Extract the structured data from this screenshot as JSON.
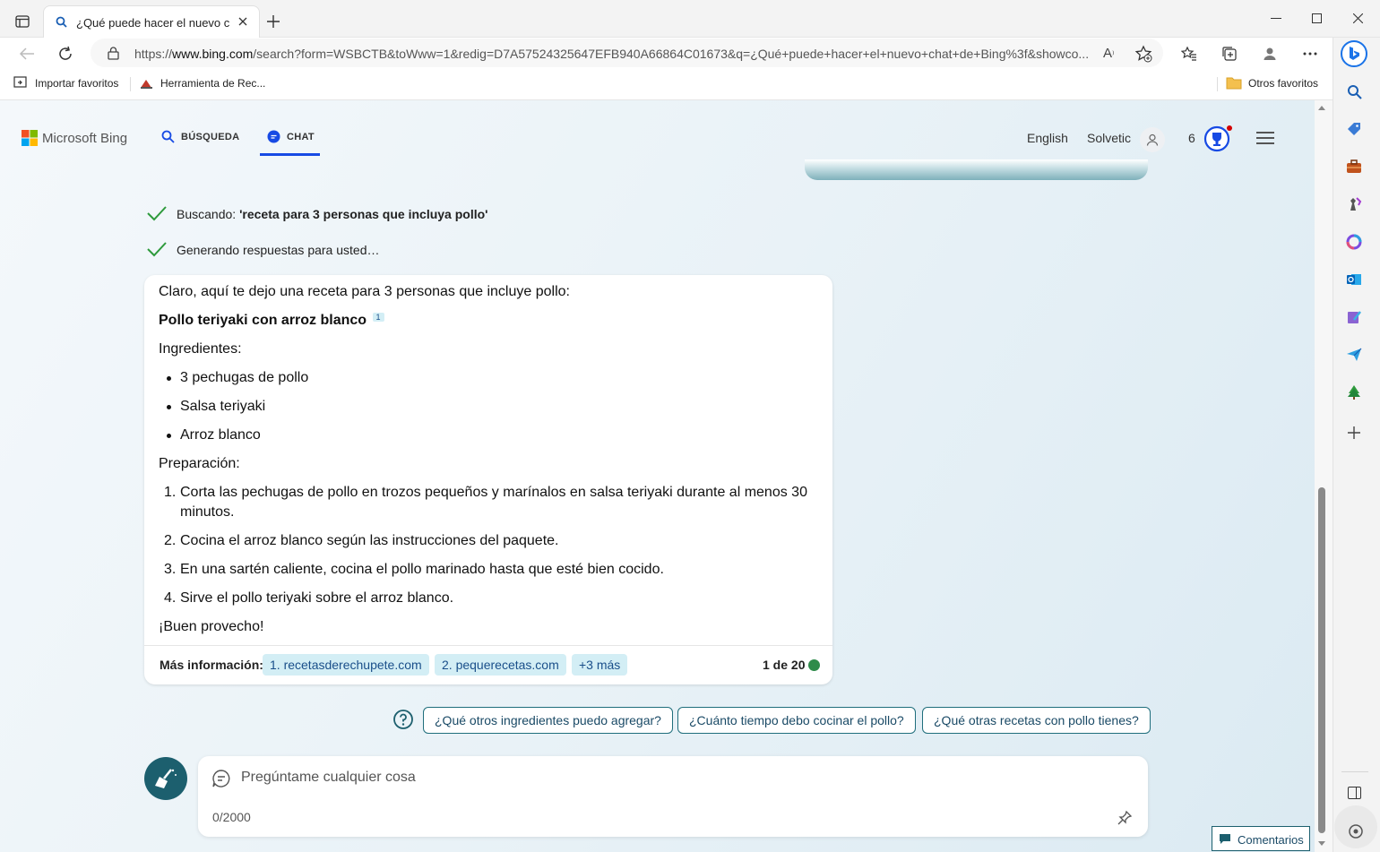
{
  "browser": {
    "tab_title": "¿Qué puede hacer el nuevo chat",
    "url_prefix": "https://",
    "url_host": "www.bing.com",
    "url_rest": "/search?form=WSBCTB&toWww=1&redig=D7A57524325647EFB940A66864C01673&q=¿Qué+puede+hacer+el+nuevo+chat+de+Bing%3f&showco...",
    "favorites": {
      "import": "Importar favoritos",
      "tool": "Herramienta de Rec...",
      "others": "Otros favoritos"
    }
  },
  "header": {
    "logo": "Microsoft Bing",
    "nav_search": "BÚSQUEDA",
    "nav_chat": "CHAT",
    "language": "English",
    "user": "Solvetic",
    "rewards_count": "6"
  },
  "chat": {
    "status_search_prefix": "Buscando: ",
    "status_search_query": "'receta para 3 personas que incluya pollo'",
    "status_generating": "Generando respuestas para usted…",
    "intro": "Claro, aquí te dejo una receta para 3 personas que incluye pollo:",
    "recipe_title": "Pollo teriyaki con arroz blanco",
    "citation": "1",
    "ingredients_heading": "Ingredientes:",
    "ingredients": [
      "3 pechugas de pollo",
      "Salsa teriyaki",
      "Arroz blanco"
    ],
    "prep_heading": "Preparación:",
    "steps": [
      {
        "num": "1.",
        "line1": "Corta las pechugas de pollo en trozos pequeños y marínalos en salsa teriyaki durante al menos 30",
        "line2": "minutos."
      },
      {
        "num": "2.",
        "line1": "Cocina el arroz blanco según las instrucciones del paquete."
      },
      {
        "num": "3.",
        "line1": "En una sartén caliente, cocina el pollo marinado hasta que esté bien cocido."
      },
      {
        "num": "4.",
        "line1": "Sirve el pollo teriyaki sobre el arroz blanco."
      }
    ],
    "closing": "¡Buen provecho!",
    "more_info_label": "Más información:",
    "sources": [
      "1. recetasderechupete.com",
      "2. pequerecetas.com",
      "+3 más"
    ],
    "counter": "1 de 20",
    "suggestions": [
      "¿Qué otros ingredientes puedo agregar?",
      "¿Cuánto tiempo debo cocinar el pollo?",
      "¿Qué otras recetas con pollo tienes?"
    ],
    "input_placeholder": "Pregúntame cualquier cosa",
    "char_count": "0/2000",
    "feedback": "Comentarios"
  },
  "colors": {
    "accent": "#174ae4",
    "teal": "#1c5f6e",
    "check": "#2e9a3c",
    "chip_bg": "#d3eef5"
  }
}
